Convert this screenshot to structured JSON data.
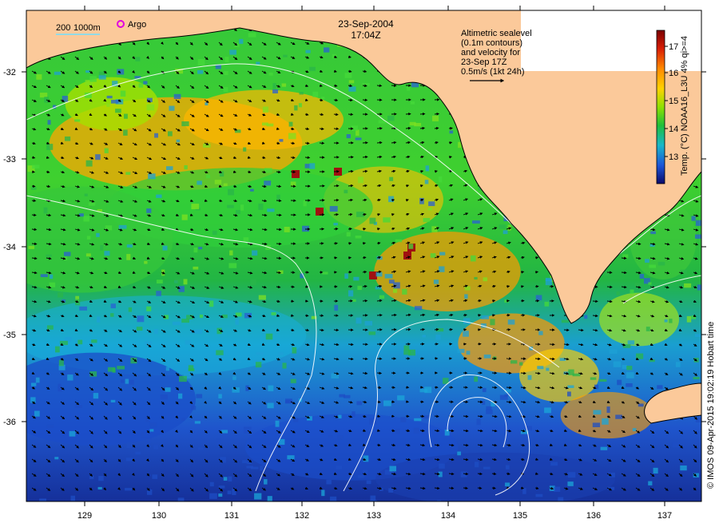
{
  "title": {
    "date": "23-Sep-2004",
    "time": "17:04Z"
  },
  "depth_legend": {
    "label1": "200",
    "label2": "1000m"
  },
  "argo_label": "Argo",
  "vector_note": {
    "lines": [
      "Altimetric sealevel",
      "(0.1m contours)",
      "and velocity for",
      "23-Sep 17Z",
      "0.5m/s (1kt 24h)"
    ]
  },
  "colorbar": {
    "label": "Temp. (°C) NOAA16_L3U 4% qi>=4",
    "ticks": [
      "17",
      "16",
      "15",
      "14",
      "13"
    ]
  },
  "x_ticks": [
    "129",
    "130",
    "131",
    "132",
    "133",
    "134",
    "135",
    "136",
    "137"
  ],
  "y_ticks": [
    "-32",
    "-33",
    "-34",
    "-35",
    "-36"
  ],
  "credit": "© IMOS 09-Apr-2015 19:02:19 Hobart time",
  "colors": {
    "land": "#fbc99a",
    "cool": "#1a3fb0",
    "warm": "#ffa500"
  }
}
